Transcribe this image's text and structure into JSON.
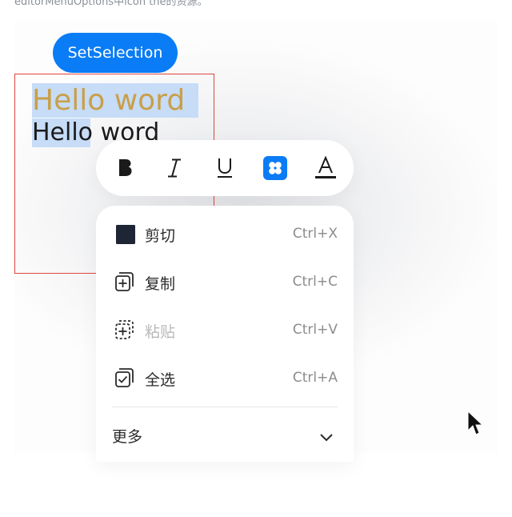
{
  "caption": "editorMenuOptions中icon the的资源。",
  "set_selection_button": {
    "label": "SetSelection"
  },
  "editor": {
    "line1": "Hello word",
    "line2": "Hello word"
  },
  "toolbar": {
    "items": [
      {
        "icon": "bold-icon"
      },
      {
        "icon": "italic-icon"
      },
      {
        "icon": "underline-icon"
      },
      {
        "icon": "apps-icon",
        "active": true
      },
      {
        "icon": "font-color-icon"
      }
    ],
    "accent_color": "#0a7cf5"
  },
  "menu": {
    "items": [
      {
        "label": "剪切",
        "shortcut": "Ctrl+X",
        "icon": "cut-icon"
      },
      {
        "label": "复制",
        "shortcut": "Ctrl+C",
        "icon": "copy-icon"
      },
      {
        "label": "粘贴",
        "shortcut": "Ctrl+V",
        "icon": "paste-icon",
        "disabled": true
      },
      {
        "label": "全选",
        "shortcut": "Ctrl+A",
        "icon": "select-all-icon"
      }
    ],
    "more_label": "更多"
  }
}
